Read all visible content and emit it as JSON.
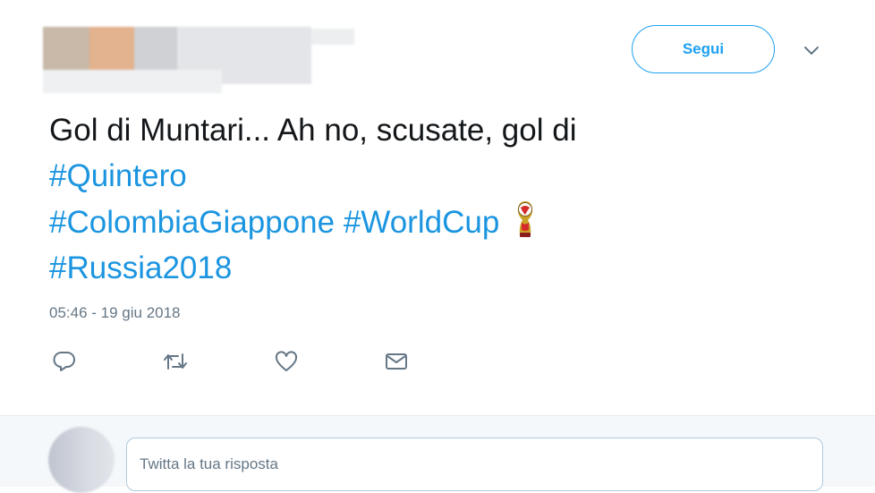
{
  "header": {
    "follow_label": "Segui"
  },
  "tweet": {
    "text_line1": "Gol di Muntari... Ah no, scusate, gol di",
    "hashtags": {
      "quintero": "#Quintero",
      "colombia_giappone": "#ColombiaGiappone",
      "world_cup": "#WorldCup",
      "russia_2018": "#Russia2018"
    },
    "emoji": "world-cup-trophy-icon",
    "timestamp": "05:46 - 19 giu 2018"
  },
  "actions": {
    "icons": [
      "reply-icon",
      "retweet-icon",
      "like-icon",
      "direct-message-icon"
    ]
  },
  "reply": {
    "placeholder": "Twitta la tua risposta"
  },
  "colors": {
    "accent": "#1da1f2",
    "hashtag": "#1b95e0",
    "text": "#14171a",
    "muted": "#657786"
  }
}
